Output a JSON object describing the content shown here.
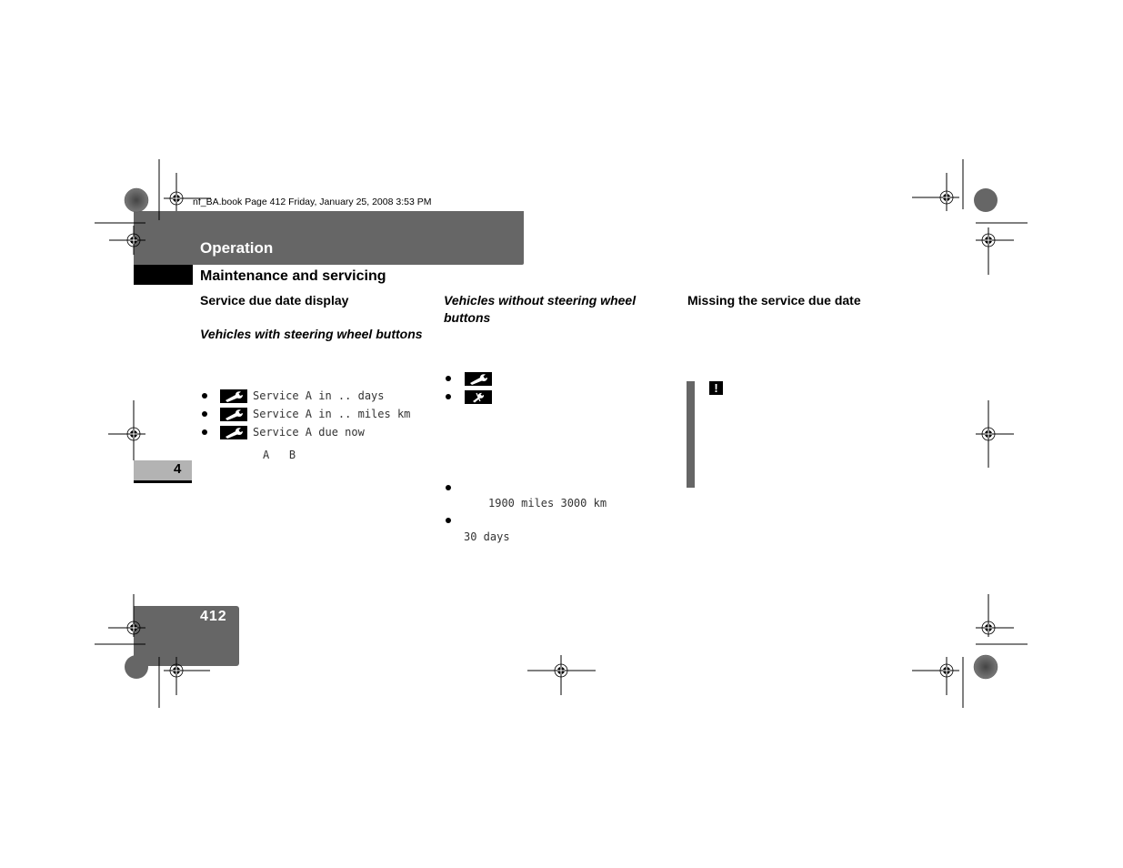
{
  "print_slug": "nf_BA.book  Page 412  Friday, January 25, 2008  3:53 PM",
  "header": {
    "chapter_title": "Operation",
    "section_title": "Maintenance and servicing"
  },
  "column1": {
    "heading": "Service due date display",
    "subheading": "Vehicles with steering wheel buttons",
    "items": [
      {
        "icon": "wrench-icon",
        "text": "Service A in .. days"
      },
      {
        "icon": "wrench-icon",
        "text": "Service A in .. miles  km"
      },
      {
        "icon": "wrench-icon",
        "text": "Service A due now"
      }
    ],
    "service_types": "A   B"
  },
  "column2": {
    "subheading": "Vehicles without steering wheel buttons",
    "icon_items": [
      {
        "icon": "wrench-icon"
      },
      {
        "icon": "wrench-warning-icon"
      }
    ],
    "items": [
      {
        "text": "1900 miles 3000 km"
      },
      {
        "text": "30 days"
      }
    ]
  },
  "column3": {
    "heading": "Missing the service due date",
    "note_icon": "exclamation-icon",
    "note_symbol": "!"
  },
  "chapter_number": "4",
  "page_number": "412",
  "colors": {
    "header_gray": "#666666",
    "chapter_tab_gray": "#b3b3b3"
  }
}
